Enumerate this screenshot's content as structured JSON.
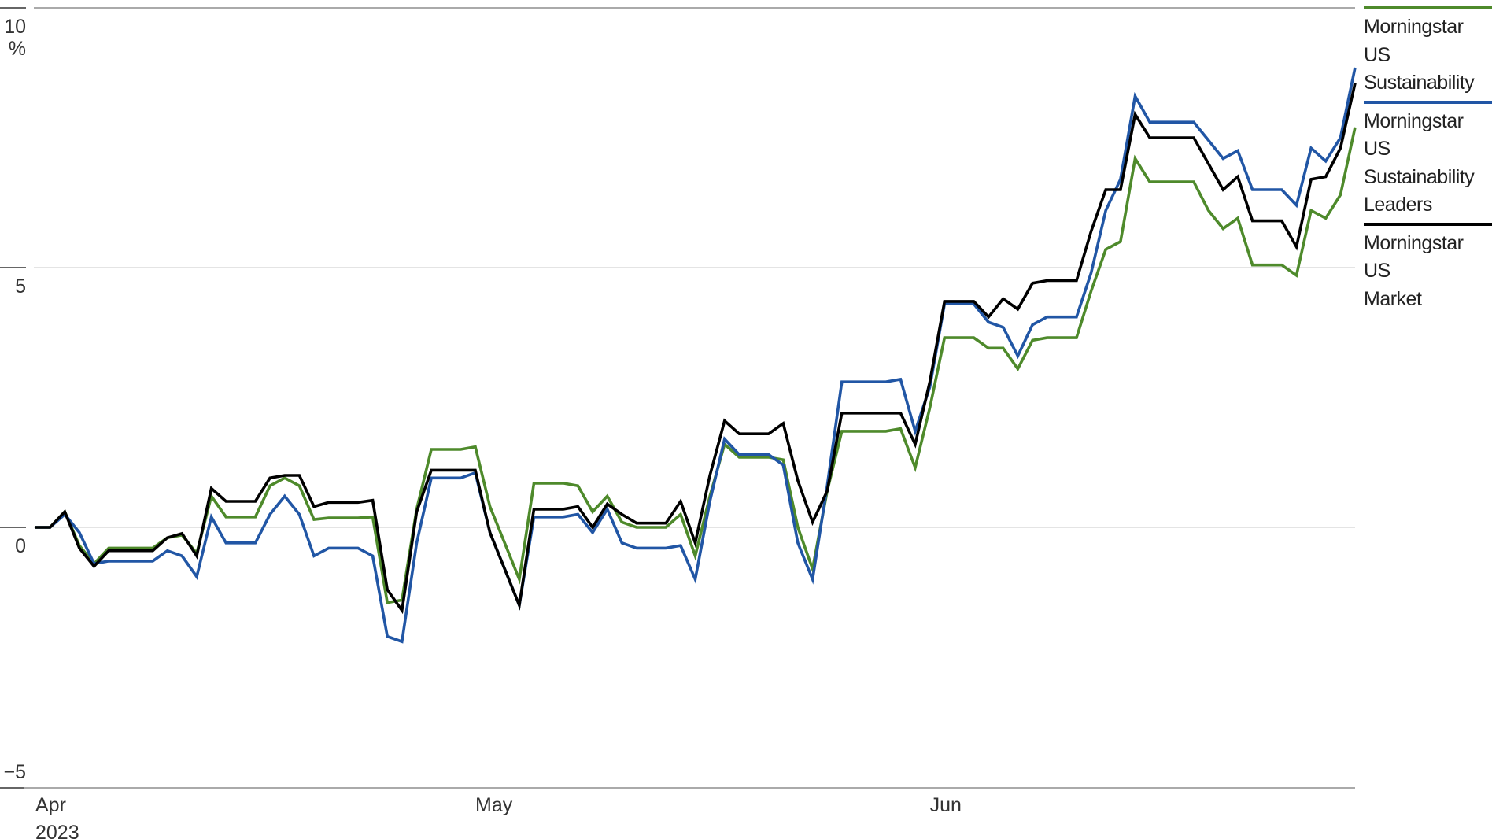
{
  "chart_data": {
    "type": "line",
    "title": "",
    "xlabel": "",
    "ylabel": "%",
    "ylim": [
      -5,
      10
    ],
    "y_ticks": [
      {
        "value": 10,
        "label": "10"
      },
      {
        "value": 5,
        "label": "5"
      },
      {
        "value": 0,
        "label": "0"
      },
      {
        "value": -5,
        "label": "−5"
      }
    ],
    "y_unit_label": "%",
    "x_ticks": [
      {
        "day_index": 0,
        "label": "Apr",
        "sublabel": "2023"
      },
      {
        "day_index": 30,
        "label": "May",
        "sublabel": ""
      },
      {
        "day_index": 61,
        "label": "Jun",
        "sublabel": ""
      }
    ],
    "x_range_days": [
      0,
      90
    ],
    "x_start_date": "2023-04-01",
    "x_end_date": "2023-06-30",
    "grid": true,
    "legend_position": "right",
    "series": [
      {
        "name": "Morningstar US Sustainability",
        "label_lines": [
          "Morningstar",
          "US",
          "Sustainability"
        ],
        "color": "#4e8a2b",
        "values": [
          0,
          0,
          0.3,
          -0.35,
          -0.7,
          -0.4,
          -0.4,
          -0.4,
          -0.4,
          -0.2,
          -0.15,
          -0.5,
          0.6,
          0.2,
          0.2,
          0.2,
          0.8,
          0.95,
          0.8,
          0.15,
          0.18,
          0.18,
          0.18,
          0.2,
          -1.45,
          -1.4,
          0.35,
          1.5,
          1.5,
          1.5,
          1.55,
          0.4,
          -0.3,
          -1.0,
          0.85,
          0.85,
          0.85,
          0.8,
          0.3,
          0.6,
          0.1,
          0.0,
          0.0,
          0.0,
          0.25,
          -0.55,
          0.6,
          1.6,
          1.35,
          1.35,
          1.35,
          1.3,
          0.0,
          -0.8,
          0.7,
          1.85,
          1.85,
          1.85,
          1.85,
          1.9,
          1.15,
          2.3,
          3.65,
          3.65,
          3.65,
          3.45,
          3.45,
          3.05,
          3.6,
          3.65,
          3.65,
          3.65,
          4.55,
          5.35,
          5.5,
          7.1,
          6.65,
          6.65,
          6.65,
          6.65,
          6.1,
          5.75,
          5.95,
          5.05,
          5.05,
          5.05,
          4.85,
          6.1,
          5.95,
          6.4,
          7.7
        ]
      },
      {
        "name": "Morningstar US Sustainability Leaders",
        "label_lines": [
          "Morningstar",
          "US",
          "Sustainability",
          "Leaders"
        ],
        "color": "#2156a5",
        "values": [
          0,
          0,
          0.25,
          -0.1,
          -0.7,
          -0.65,
          -0.65,
          -0.65,
          -0.65,
          -0.45,
          -0.55,
          -0.95,
          0.2,
          -0.3,
          -0.3,
          -0.3,
          0.25,
          0.6,
          0.25,
          -0.55,
          -0.4,
          -0.4,
          -0.4,
          -0.55,
          -2.1,
          -2.2,
          -0.3,
          0.95,
          0.95,
          0.95,
          1.05,
          -0.1,
          -0.8,
          -1.5,
          0.2,
          0.2,
          0.2,
          0.25,
          -0.1,
          0.35,
          -0.3,
          -0.4,
          -0.4,
          -0.4,
          -0.35,
          -1.0,
          0.5,
          1.7,
          1.4,
          1.4,
          1.4,
          1.2,
          -0.3,
          -1.0,
          0.8,
          2.8,
          2.8,
          2.8,
          2.8,
          2.85,
          1.85,
          2.7,
          4.3,
          4.3,
          4.3,
          3.95,
          3.85,
          3.3,
          3.9,
          4.05,
          4.05,
          4.05,
          4.9,
          6.1,
          6.7,
          8.3,
          7.8,
          7.8,
          7.8,
          7.8,
          7.45,
          7.1,
          7.25,
          6.5,
          6.5,
          6.5,
          6.2,
          7.3,
          7.05,
          7.5,
          8.85
        ]
      },
      {
        "name": "Morningstar US Market",
        "label_lines": [
          "Morningstar",
          "US",
          "Market"
        ],
        "color": "#000000",
        "values": [
          0,
          0,
          0.3,
          -0.4,
          -0.75,
          -0.45,
          -0.45,
          -0.45,
          -0.45,
          -0.2,
          -0.12,
          -0.55,
          0.75,
          0.5,
          0.5,
          0.5,
          0.95,
          1.0,
          1.0,
          0.4,
          0.48,
          0.48,
          0.48,
          0.52,
          -1.2,
          -1.6,
          0.3,
          1.1,
          1.1,
          1.1,
          1.1,
          -0.1,
          -0.8,
          -1.5,
          0.35,
          0.35,
          0.35,
          0.4,
          0.0,
          0.45,
          0.25,
          0.08,
          0.08,
          0.08,
          0.5,
          -0.3,
          1.0,
          2.05,
          1.8,
          1.8,
          1.8,
          2.0,
          0.9,
          0.1,
          0.7,
          2.2,
          2.2,
          2.2,
          2.2,
          2.2,
          1.6,
          2.8,
          4.35,
          4.35,
          4.35,
          4.05,
          4.4,
          4.2,
          4.7,
          4.75,
          4.75,
          4.75,
          5.7,
          6.5,
          6.5,
          7.95,
          7.5,
          7.5,
          7.5,
          7.5,
          7.0,
          6.5,
          6.75,
          5.9,
          5.9,
          5.9,
          5.4,
          6.7,
          6.75,
          7.3,
          8.55
        ]
      }
    ]
  }
}
